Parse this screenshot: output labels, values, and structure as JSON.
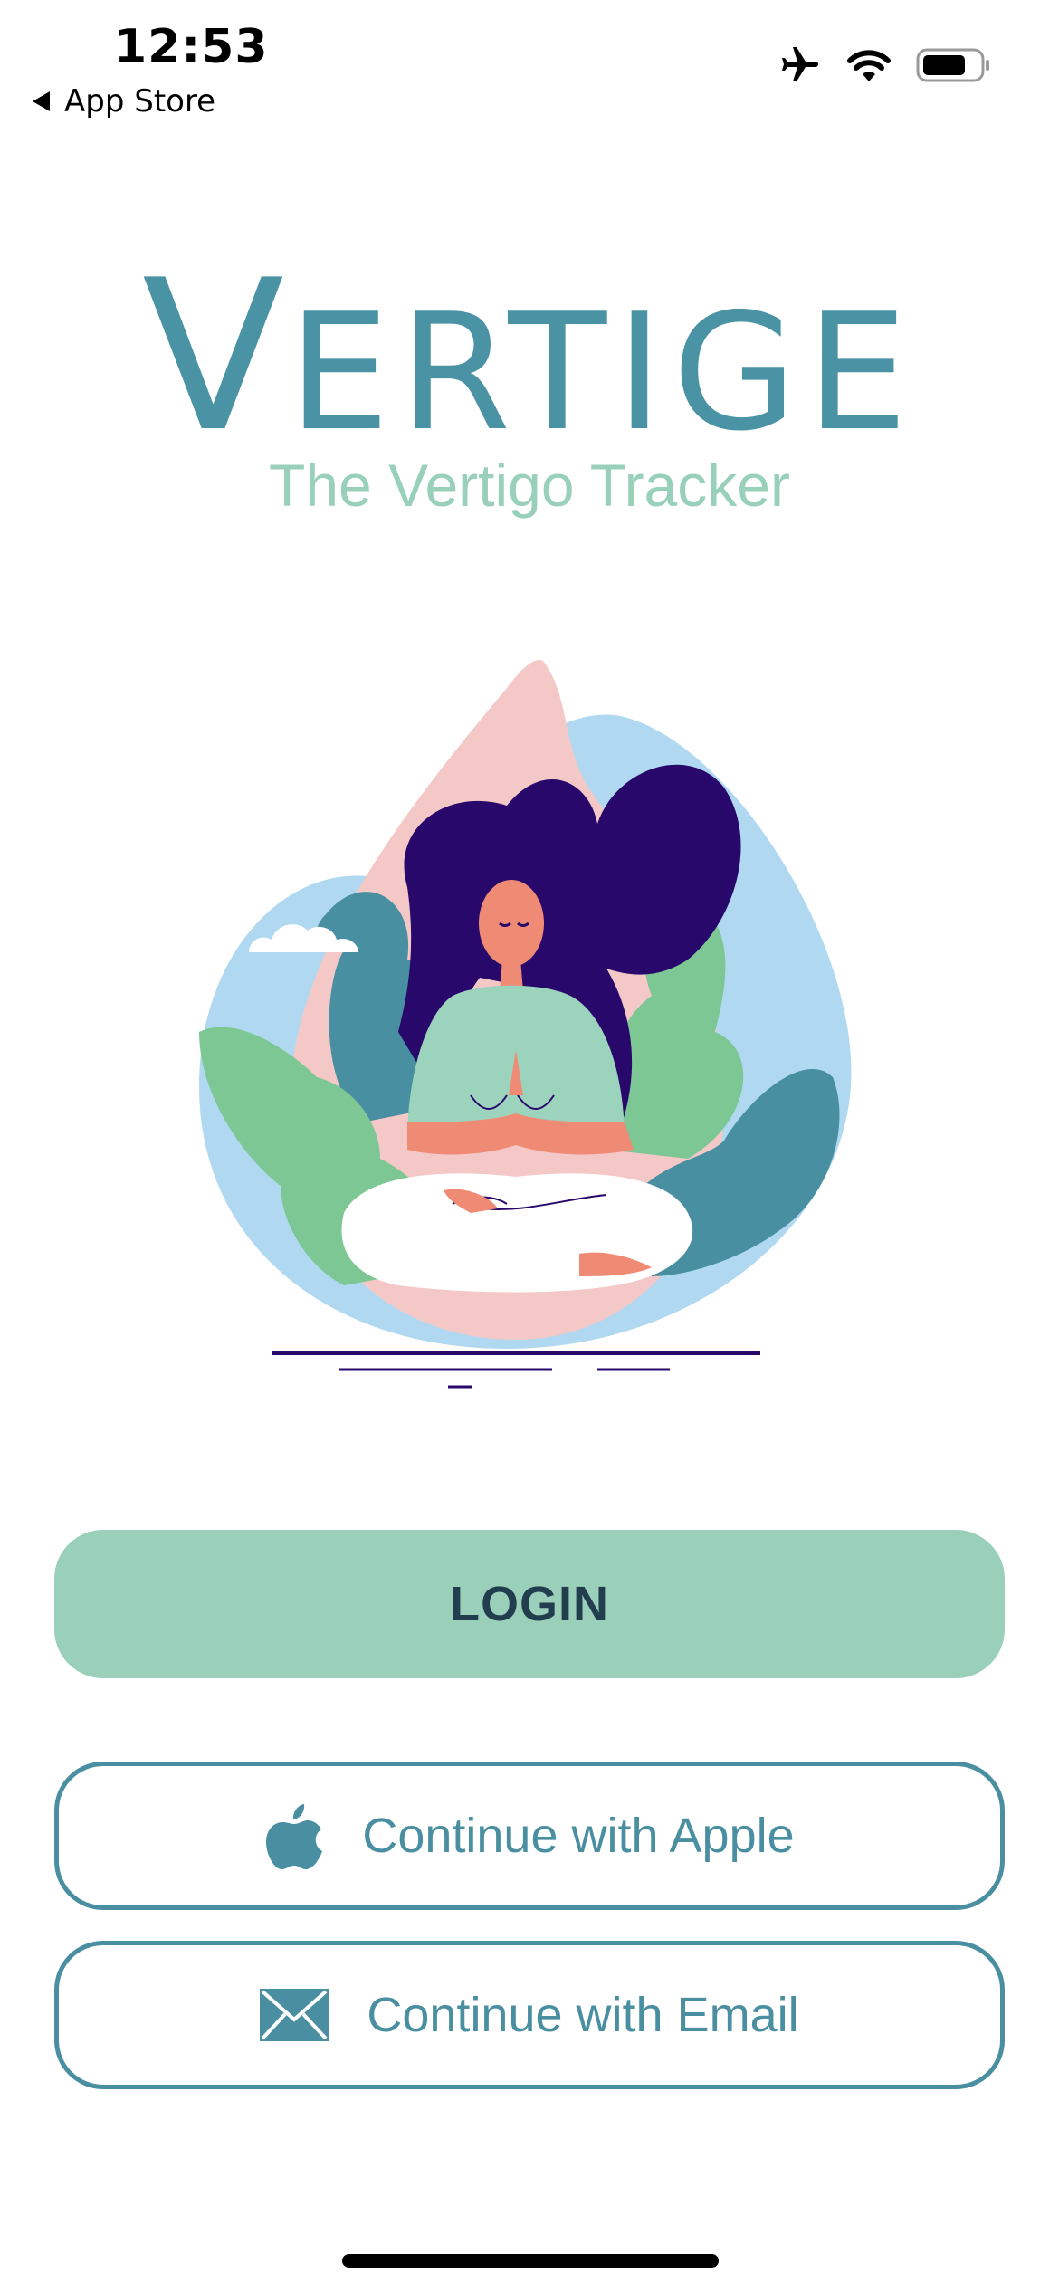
{
  "status_bar": {
    "time": "12:53",
    "back_label": "App Store",
    "icons": [
      "airplane-mode-icon",
      "wifi-icon",
      "battery-icon"
    ]
  },
  "logo": {
    "first_letter": "V",
    "rest": "ERTIGE",
    "tagline": "The Vertigo Tracker"
  },
  "illustration": {
    "description_icon": "meditating-woman-illustration"
  },
  "buttons": {
    "login": "LOGIN",
    "apple": "Continue with Apple",
    "email": "Continue with Email"
  },
  "colors": {
    "brand_teal": "#4a93a5",
    "mint": "#9ad0b9",
    "tagline_mint": "#98d0ba",
    "login_text": "#223e4e"
  }
}
